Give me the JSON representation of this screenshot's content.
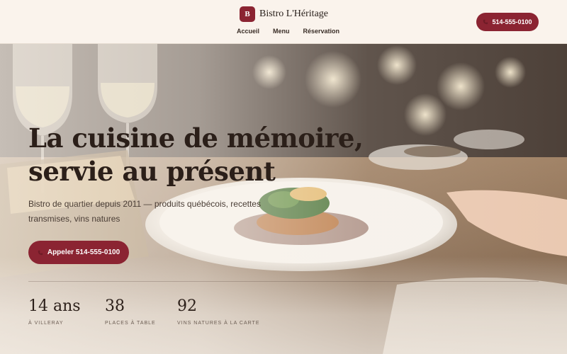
{
  "header": {
    "logo_letter": "B",
    "brand_name": "Bistro L'Héritage",
    "nav": [
      "Accueil",
      "Menu",
      "Réservation"
    ],
    "phone_button": "514-555-0100"
  },
  "hero": {
    "title_line1": "La cuisine de mémoire,",
    "title_line2": "servie au présent",
    "subtitle": "Bistro de quartier depuis 2011 — produits québécois, recettes transmises, vins natures",
    "cta": "Appeler 514-555-0100"
  },
  "stats": [
    {
      "value": "14 ans",
      "label": "À VILLERAY"
    },
    {
      "value": "38",
      "label": "PLACES À TABLE"
    },
    {
      "value": "92",
      "label": "VINS NATURES À LA CARTE"
    }
  ],
  "colors": {
    "accent": "#8b2432",
    "background": "#faf3ec"
  }
}
